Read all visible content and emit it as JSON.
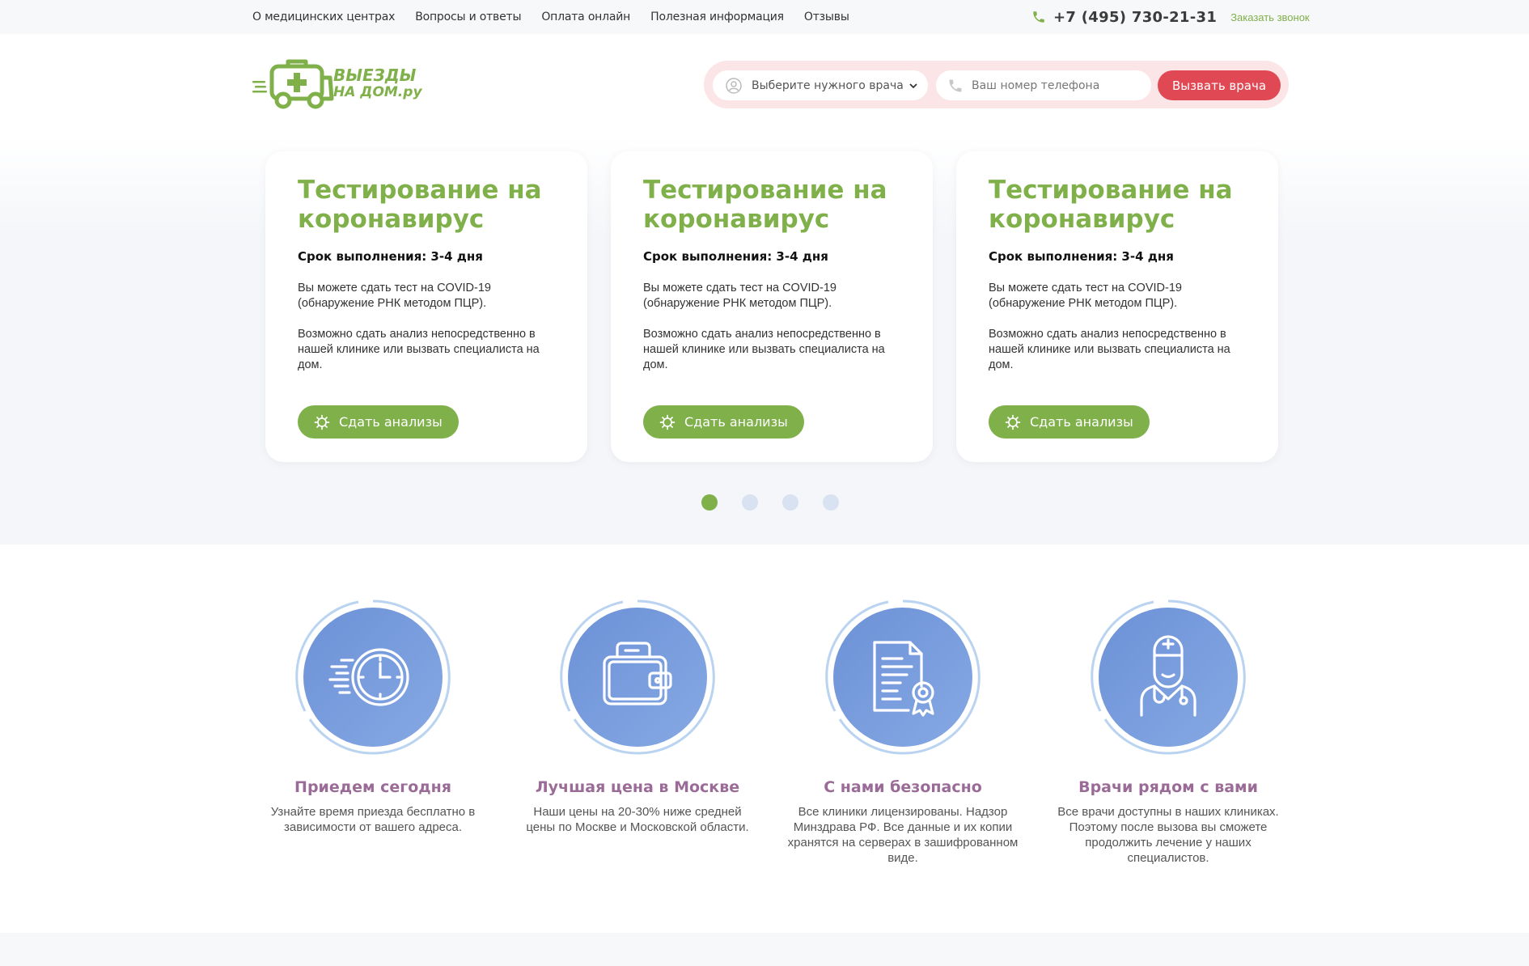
{
  "topnav": {
    "items": [
      "О медицинских центрах",
      "Вопросы и ответы",
      "Оплата онлайн",
      "Полезная информация",
      "Отзывы"
    ],
    "phone": "+7 (495) 730-21-31",
    "callback": "Заказать звонок"
  },
  "header": {
    "logo_line1": "ВЫЕЗДЫ",
    "logo_line2": "НА ДОМ.ру",
    "select_value": "Выберите нужного врача",
    "phone_placeholder": "Ваш номер телефона",
    "call_button": "Вызвать врача"
  },
  "slider": {
    "cards": [
      {
        "title": "Тестирование на коронавирус",
        "term": "Срок выполнения: 3-4 дня",
        "text1": "Вы можете сдать тест на COVID-19 (обнаружение РНК методом ПЦР).",
        "text2": "Возможно сдать анализ непосредственно в нашей клинике или вызвать специалиста на дом.",
        "button": "Сдать анализы"
      },
      {
        "title": "Тестирование на коронавирус",
        "term": "Срок выполнения: 3-4 дня",
        "text1": "Вы можете сдать тест на COVID-19 (обнаружение РНК методом ПЦР).",
        "text2": "Возможно сдать анализ непосредственно в нашей клинике или вызвать специалиста на дом.",
        "button": "Сдать анализы"
      },
      {
        "title": "Тестирование на коронавирус",
        "term": "Срок выполнения: 3-4 дня",
        "text1": "Вы можете сдать тест на COVID-19 (обнаружение РНК методом ПЦР).",
        "text2": "Возможно сдать анализ непосредственно в нашей клинике или вызвать специалиста на дом.",
        "button": "Сдать анализы"
      }
    ],
    "active_page": 1,
    "page_count": 4
  },
  "features": [
    {
      "icon": "fast-clock-icon",
      "title": "Приедем сегодня",
      "text": "Узнайте время приезда бесплатно в зависимости от вашего адреса."
    },
    {
      "icon": "wallet-icon",
      "title": "Лучшая цена в Москве",
      "text": "Наши цены на 20-30% ниже средней цены по Москве и Московской области."
    },
    {
      "icon": "certificate-icon",
      "title": "С нами безопасно",
      "text": "Все клиники лицензированы. Надзор Минздрава РФ. Все данные и их копии хранятся на серверах в зашифрованном виде."
    },
    {
      "icon": "doctor-icon",
      "title": "Врачи рядом с вами",
      "text": "Все врачи доступны в наших клиниках. Поэтому после вызова вы сможете продолжить лечение у наших специалистов."
    }
  ],
  "colors": {
    "green": "#7fb04a",
    "red": "#e04954",
    "purple": "#9b6b97",
    "blue": "#6c91d6"
  }
}
